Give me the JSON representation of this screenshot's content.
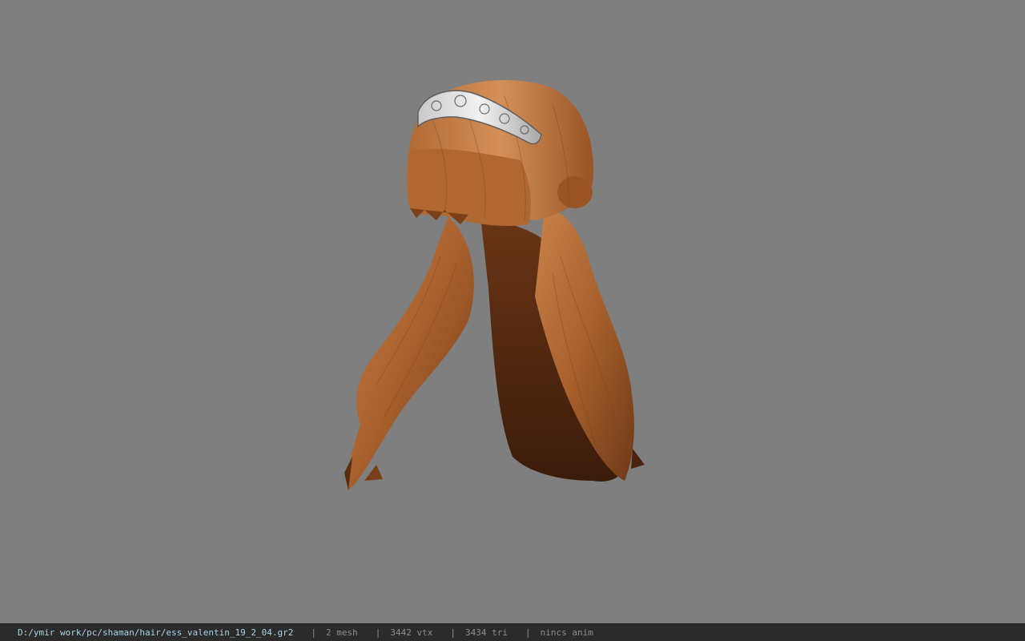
{
  "viewer": {
    "background_color": "#7f7f7f",
    "model_icon": "hair-model-icon"
  },
  "statusbar": {
    "file_path": "D:/ymir work/pc/shaman/hair/ess_valentin_19_2_04.gr2",
    "separator": "|",
    "mesh": "2 mesh",
    "vtx": "3442 vtx",
    "tri": "3434 tri",
    "anim": "nincs anim",
    "path_color": "#a8d4e6",
    "text_color": "#8e8e8e"
  }
}
